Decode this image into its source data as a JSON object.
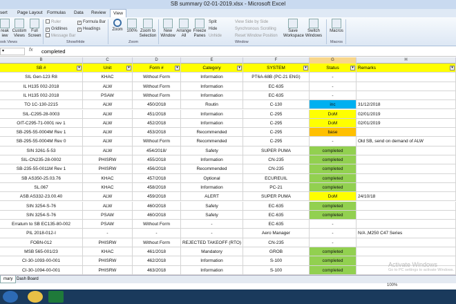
{
  "window": {
    "title": "SB summary 02-01-2019.xlsx - Microsoft Excel"
  },
  "tabs": [
    {
      "label": "sert"
    },
    {
      "label": "Page Layout"
    },
    {
      "label": "Formulas"
    },
    {
      "label": "Data"
    },
    {
      "label": "Review"
    },
    {
      "label": "View"
    }
  ],
  "ribbon": {
    "workbook_views": {
      "break_view": "reak\niew",
      "custom_views": "Custom\nViews",
      "full_screen": "Full\nScreen",
      "label": "ook Views"
    },
    "show_hide": {
      "ruler": "Ruler",
      "gridlines": "Gridlines",
      "message_bar": "Message Bar",
      "formula_bar": "Formula Bar",
      "headings": "Headings",
      "label": "Show/Hide"
    },
    "zoom": {
      "zoom": "Zoom",
      "zoom100": "100%",
      "zoom_sel": "Zoom to\nSelection",
      "label": "Zoom"
    },
    "window": {
      "new_window": "New\nWindow",
      "arrange_all": "Arrange\nAll",
      "freeze": "Freeze\nPanes",
      "split": "Split",
      "hide": "Hide",
      "unhide": "Unhide",
      "side_by_side": "View Side by Side",
      "sync_scroll": "Synchronous Scrolling",
      "reset_pos": "Reset Window Position",
      "save_ws": "Save\nWorkspace",
      "switch_win": "Switch\nWindows",
      "label": "Window"
    },
    "macros": {
      "macros": "Macros",
      "label": "Macros"
    }
  },
  "formula_bar": {
    "fx": "fx",
    "value": "completed"
  },
  "columns": [
    "B",
    "C",
    "D",
    "E",
    "F",
    "G",
    "H"
  ],
  "headers": [
    "SB #",
    "Unit",
    "Form #",
    "Category",
    "SYSTEM",
    "Status",
    "Remarks"
  ],
  "rows": [
    [
      "SIL Gen-123 R8",
      "KHAC",
      "Without Form",
      "Information",
      "PT6A-68B (PC-21 ENG)",
      "-",
      ""
    ],
    [
      "IL H135 002-2018",
      "ALW",
      "Without Form",
      "Information",
      "EC-635",
      "-",
      ""
    ],
    [
      "IL H135 002-2018",
      "PSAW",
      "Without Form",
      "Information",
      "EC-635",
      "-",
      ""
    ],
    [
      "TO 1C-130-2215",
      "ALW",
      "450/2018",
      "Routin",
      "C-130",
      "inc",
      "31/12/2018"
    ],
    [
      "SIL-C295-28-0003",
      "ALW",
      "451/2018",
      "Information",
      "C-295",
      "DoM",
      "02/01/2019"
    ],
    [
      "OIT-C295-71-0001 rev 1",
      "ALW",
      "452/2018",
      "Information",
      "C-295",
      "DoM",
      "02/01/2019"
    ],
    [
      "SB-295-55-0004M Rev 1",
      "ALW",
      "453/2018",
      "Recommended",
      "C-295",
      "base",
      ""
    ],
    [
      "SB-295-55-0004M Rev 0",
      "ALW",
      "Without Form",
      "Recommended",
      "C-295",
      "-",
      "Old SB, send on demand of ALW"
    ],
    [
      "SIN 3261-5-53",
      "ALW",
      "454/2018/",
      "Safety",
      "SUPER PUMA",
      "completed",
      ""
    ],
    [
      "SIL-CN235-28-0002",
      "PHISRW",
      "455/2018",
      "Information",
      "CN-235",
      "completed",
      ""
    ],
    [
      "SB-235-55-0011M Rev 1",
      "PHISRW",
      "456/2018",
      "Recommended",
      "CN-235",
      "completed",
      ""
    ],
    [
      "SB AS350-25.03.76",
      "KHAC",
      "457/2018",
      "Optional",
      "ECUREUIL",
      "completed",
      ""
    ],
    [
      "SL.067",
      "KHAC",
      "458/2018",
      "Information",
      "PC-21",
      "completed",
      ""
    ],
    [
      "ASB AS332-23.00.40",
      "ALW",
      "459/2018",
      "ALERT",
      "SUPER PUMA",
      "DoM",
      "24/10/18"
    ],
    [
      "SIN 3254-S-76",
      "ALW",
      "460/2018",
      "Safety",
      "EC-635",
      "completed",
      ""
    ],
    [
      "SIN 3254-S-76",
      "PSAW",
      "460/2018",
      "Safety",
      "EC-635",
      "completed",
      ""
    ],
    [
      "Erratum to SB EC135-80-002",
      "PSAW",
      "Without Form",
      "-",
      "EC-635",
      "-",
      ""
    ],
    [
      "PIL 2018-012-I",
      "-",
      "-",
      "-",
      "Aero Manager",
      "-",
      "N/A ,M250 C47 Series"
    ],
    [
      "FOBN-012",
      "PHISRW",
      "Without Form",
      "REJECTED TAKEOFF (RTO)",
      "CN-235",
      "-",
      ""
    ],
    [
      "MSB 565-001/23",
      "KHAC",
      "461/2018",
      "Mandatory",
      "GROB",
      "completed",
      ""
    ],
    [
      "CI-30-1093-00-001",
      "PHISRW",
      "462/2018",
      "Information",
      "S-100",
      "completed",
      ""
    ],
    [
      "CI-30-1094-00-001",
      "PHISRW",
      "463/2018",
      "Information",
      "S-100",
      "completed",
      ""
    ]
  ],
  "status_colors": {
    "completed": "#92d050",
    "DoM": "#ffff00",
    "inc": "#00b0f0",
    "base": "#ffc000"
  },
  "sheets": [
    {
      "label": "mary"
    },
    {
      "label": "Dash Board"
    }
  ],
  "watermark": {
    "title": "Activate Windows",
    "sub": "Go to PC settings to activate Windows."
  },
  "zoom_level": "100%"
}
